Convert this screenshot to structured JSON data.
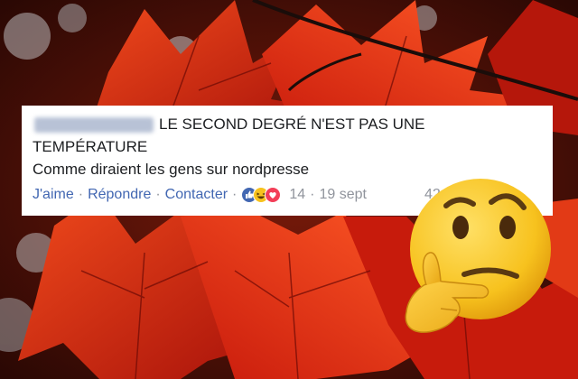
{
  "comment": {
    "author_name_blurred": "Another Member",
    "text_line1": "LE SECOND DEGRÉ N'EST PAS UNE",
    "text_line2": "TEMPÉRATURE",
    "text_line3": "Comme diraient les gens sur nordpresse"
  },
  "actions": {
    "like_label": "J'aime",
    "reply_label": "Répondre",
    "contact_label": "Contacter",
    "separator": "·",
    "reaction_count": "14",
    "timestamp": "19 sept",
    "time_partial": "42",
    "reaction_icons": [
      "like-icon",
      "haha-icon",
      "love-icon"
    ]
  },
  "overlay": {
    "emoji": "thinking-face-emoji"
  },
  "colors": {
    "link_blue": "#4267b2",
    "meta_gray": "#90949c",
    "text_dark": "#1c1e21",
    "card_bg": "#ffffff",
    "leaf_red": "#d9260f",
    "emoji_yellow": "#f7c21e"
  }
}
